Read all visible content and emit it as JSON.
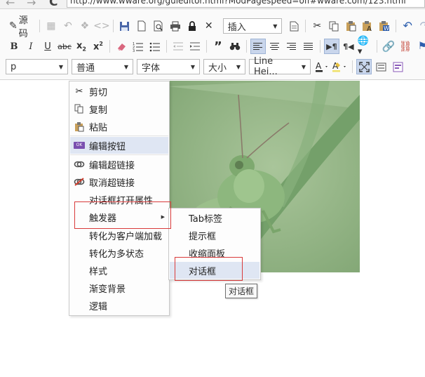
{
  "browser": {
    "url": "http://www.wware.org/guieditor.html?ModPagespeed=off#wware.com/123.html"
  },
  "toolbar": {
    "source_label": "源码",
    "insert_label": "插入",
    "paragraph_value": "p",
    "style_value": "普通",
    "font_value": "字体",
    "size_value": "大小",
    "lineheight_value": "Line Hei..."
  },
  "context_menu": {
    "items": [
      {
        "label": "剪切",
        "icon": "scissors-icon"
      },
      {
        "label": "复制",
        "icon": "copy-icon"
      },
      {
        "label": "粘贴",
        "icon": "paste-icon"
      },
      {
        "label": "编辑按钮",
        "icon": "button-icon",
        "icon_text": "OK"
      },
      {
        "label": "编辑超链接",
        "icon": "link-icon"
      },
      {
        "label": "取消超链接",
        "icon": "unlink-icon"
      },
      {
        "label": "对话框打开属性"
      },
      {
        "label": "触发器",
        "has_submenu": true
      },
      {
        "label": "转化为客户端加载"
      },
      {
        "label": "转化为多状态"
      },
      {
        "label": "样式"
      },
      {
        "label": "渐变背景"
      },
      {
        "label": "逻辑"
      }
    ]
  },
  "submenu": {
    "items": [
      {
        "label": "Tab标签"
      },
      {
        "label": "提示框"
      },
      {
        "label": "收缩面板"
      },
      {
        "label": "对话框"
      }
    ]
  },
  "tooltip": {
    "text": "对话框"
  },
  "colors": {
    "highlight": "#dfe6f3",
    "annotation_red": "#d93a3a",
    "toolbar_active": "#c9d6ec"
  }
}
